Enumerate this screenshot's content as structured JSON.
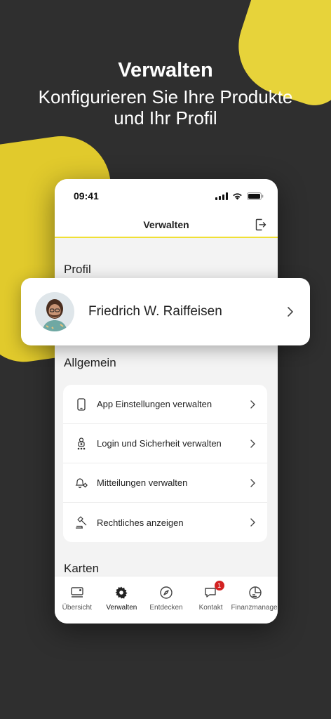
{
  "promo": {
    "title": "Verwalten",
    "subtitle": "Konfigurieren Sie Ihre Produkte und Ihr Profil"
  },
  "status_bar": {
    "time": "09:41"
  },
  "nav": {
    "title": "Verwalten",
    "logout_icon": "logout-icon"
  },
  "sections": {
    "profil": "Profil",
    "allgemein": "Allgemein",
    "karten": "Karten"
  },
  "profile": {
    "name": "Friedrich W. Raiffeisen"
  },
  "settings": [
    {
      "label": "App Einstellungen verwalten",
      "icon": "phone-icon"
    },
    {
      "label": "Login und Sicherheit verwalten",
      "icon": "lock-icon"
    },
    {
      "label": "Mitteilungen verwalten",
      "icon": "bell-gear-icon"
    },
    {
      "label": "Rechtliches anzeigen",
      "icon": "gavel-icon"
    }
  ],
  "tabs": [
    {
      "label": "Übersicht",
      "icon": "overview-icon",
      "active": false
    },
    {
      "label": "Verwalten",
      "icon": "gear-icon",
      "active": true
    },
    {
      "label": "Entdecken",
      "icon": "compass-icon",
      "active": false
    },
    {
      "label": "Kontakt",
      "icon": "chat-icon",
      "active": false,
      "badge": "1"
    },
    {
      "label": "Finanzmanager",
      "icon": "finance-icon",
      "active": false
    }
  ],
  "colors": {
    "accent": "#f0e036",
    "background": "#2f2f2f",
    "badge": "#d32222"
  }
}
